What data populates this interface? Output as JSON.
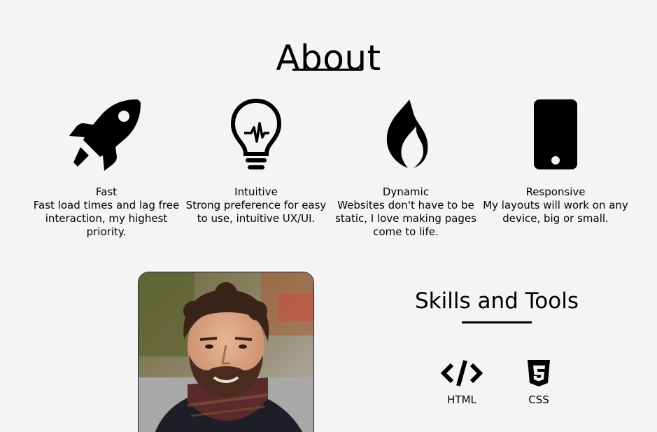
{
  "about": {
    "title": "About"
  },
  "features": [
    {
      "icon": "rocket-icon",
      "label": "Fast",
      "description": "Fast load times and lag free interaction, my highest priority."
    },
    {
      "icon": "lightbulb-icon",
      "label": "Intuitive",
      "description": "Strong preference for easy to use, intuitive UX/UI."
    },
    {
      "icon": "flame-icon",
      "label": "Dynamic",
      "description": "Websites don't have to be static, I love making pages come to life."
    },
    {
      "icon": "mobile-phone-icon",
      "label": "Responsive",
      "description": "My layouts will work on any device, big or small."
    }
  ],
  "skills": {
    "title": "Skills and Tools",
    "items": [
      {
        "icon": "code-icon",
        "label": "HTML"
      },
      {
        "icon": "css3-icon",
        "label": "CSS"
      }
    ]
  },
  "colors": {
    "background": "#f4f4f4",
    "text": "#000000"
  }
}
